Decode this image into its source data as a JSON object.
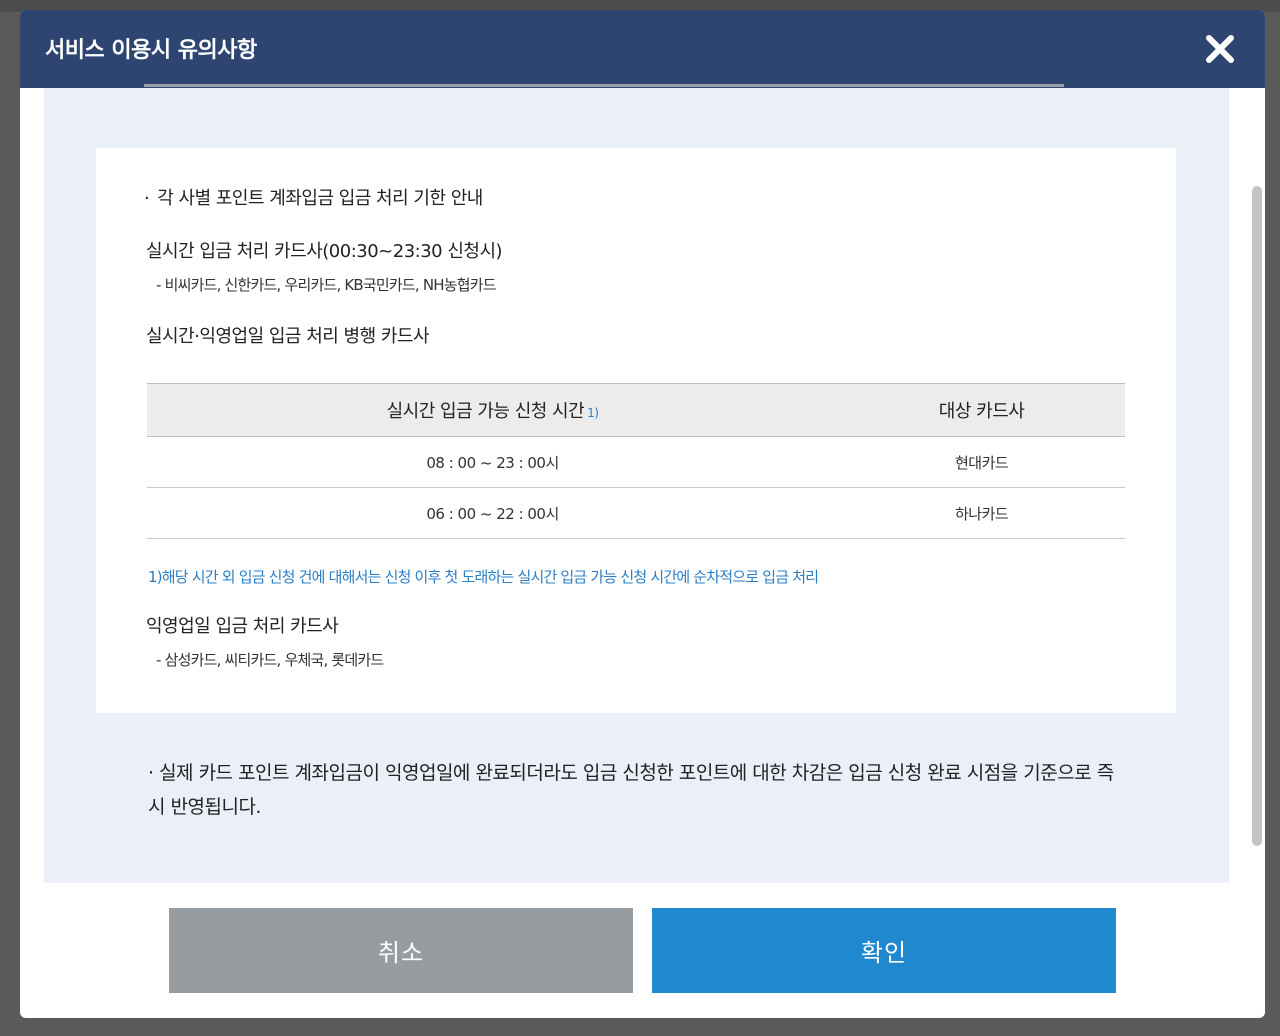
{
  "modal": {
    "title": "서비스 이용시 유의사항",
    "close_icon": "close-icon"
  },
  "info": {
    "heading": "각 사별 포인트 계좌입금 입금 처리 기한 안내",
    "bullet": "·",
    "realtime_title": "실시간 입금 처리 카드사(00:30~23:30 신청시)",
    "realtime_cards": "- 비씨카드, 신한카드, 우리카드, KB국민카드, NH농협카드",
    "parallel_title": "실시간·익영업일 입금 처리 병행 카드사",
    "table": {
      "headers": [
        "실시간 입금 가능 신청 시간",
        "대상 카드사"
      ],
      "header_ref": "1)",
      "rows": [
        [
          "08 : 00 ~ 23 : 00시",
          "현대카드"
        ],
        [
          "06 : 00 ~ 22 : 00시",
          "하나카드"
        ]
      ]
    },
    "footnote": "1)해당 시간 외 입금 신청 건에 대해서는 신청 이후 첫 도래하는 실시간 입금 가능 신청 시간에 순차적으로 입금 처리",
    "nextday_title": "익영업일 입금 처리 카드사",
    "nextday_cards": "- 삼성카드, 씨티카드, 우체국, 롯데카드"
  },
  "notice": "· 실제 카드 포인트 계좌입금이 익영업일에 완료되더라도 입금 신청한 포인트에 대한 차감은 입금 신청 완료 시점을 기준으로 즉시 반영됩니다.",
  "buttons": {
    "cancel": "취소",
    "confirm": "확인"
  },
  "colors": {
    "header": "#2d4570",
    "content_bg": "#eaeff8",
    "confirm": "#1f88cf",
    "cancel": "#979ca1",
    "footnote": "#2a7ec5"
  }
}
